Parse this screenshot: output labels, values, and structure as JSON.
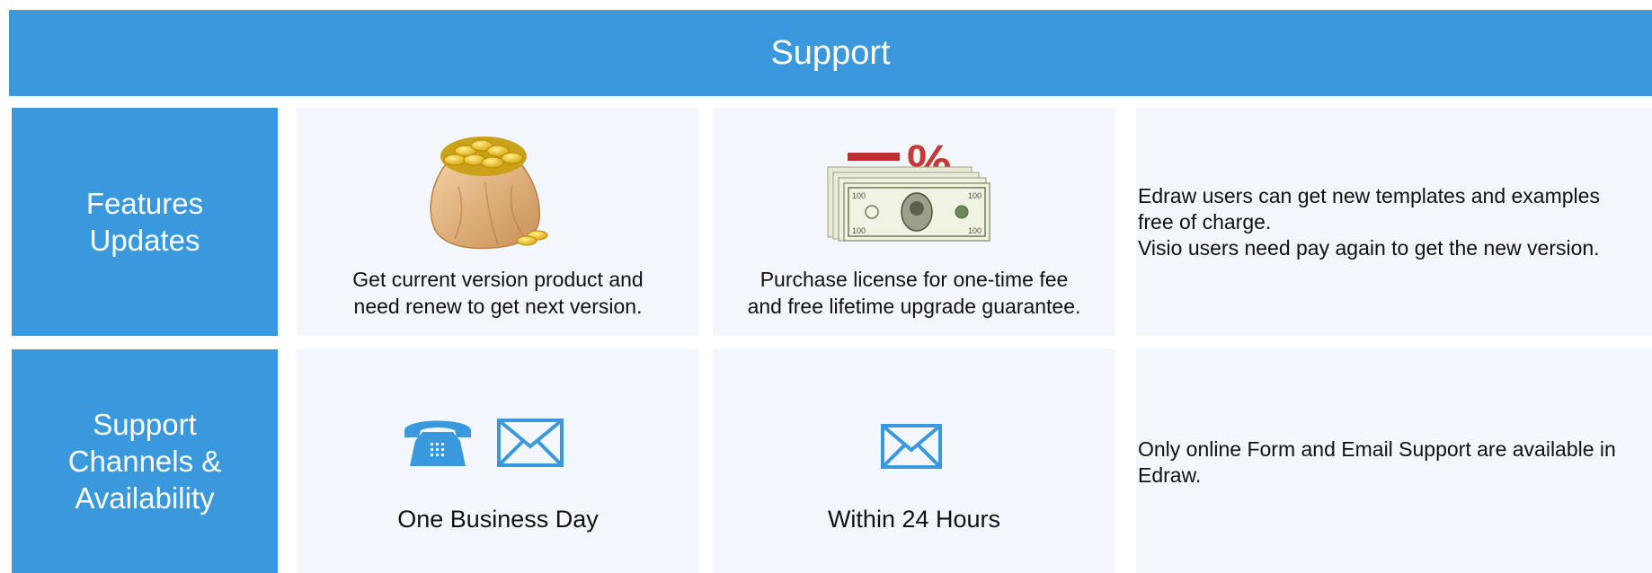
{
  "header": {
    "title": "Support"
  },
  "rows": [
    {
      "label_lines": [
        "Features",
        "Updates"
      ],
      "cells": [
        {
          "icon": "money-bag-icon",
          "caption_lines": [
            "Get current version product and",
            "need renew to get next version."
          ]
        },
        {
          "icon": "discount-dollar-icon",
          "caption_lines": [
            "Purchase license for one-time fee",
            "and free lifetime upgrade guarantee."
          ]
        }
      ],
      "note_lines": [
        "Edraw users can get new templates and examples",
        "free of charge.",
        "Visio users need pay again to get the new version."
      ]
    },
    {
      "label_lines": [
        "Support",
        "Channels &",
        "Availability"
      ],
      "cells": [
        {
          "icons": [
            "telephone-icon",
            "envelope-icon"
          ],
          "caption": "One Business Day"
        },
        {
          "icons": [
            "envelope-icon"
          ],
          "caption": "Within 24 Hours"
        }
      ],
      "note_lines": [
        "Only online Form and Email Support are available in",
        "Edraw."
      ]
    }
  ],
  "colors": {
    "accent": "#3a98dc",
    "cell_background": "#f1f7fc",
    "icon_blue": "#3a98dc"
  }
}
